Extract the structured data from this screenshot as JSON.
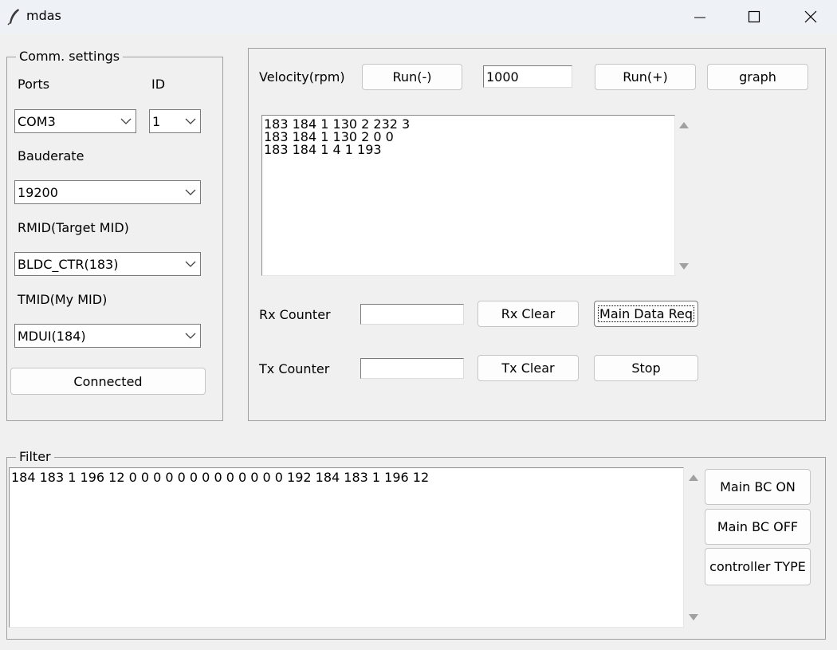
{
  "window": {
    "title": "mdas"
  },
  "comm": {
    "legend": "Comm. settings",
    "ports_label": "Ports",
    "id_label": "ID",
    "port_value": "COM3",
    "id_value": "1",
    "baud_label": "Bauderate",
    "baud_value": "19200",
    "rmid_label": "RMID(Target MID)",
    "rmid_value": "BLDC_CTR(183)",
    "tmid_label": "TMID(My MID)",
    "tmid_value": "MDUI(184)",
    "connect_label": "Connected"
  },
  "control": {
    "velocity_label": "Velocity(rpm)",
    "run_minus": "Run(-)",
    "velocity_value": "1000",
    "run_plus": "Run(+)",
    "graph": "graph",
    "log_lines": "183 184 1 130 2 232 3\n183 184 1 130 2 0 0\n183 184 1 4 1 193",
    "rx_counter_label": "Rx Counter",
    "rx_counter_value": "",
    "rx_clear": "Rx Clear",
    "main_data_req": "Main Data Req",
    "tx_counter_label": "Tx Counter",
    "tx_counter_value": "",
    "tx_clear": "Tx Clear",
    "stop": "Stop"
  },
  "filter": {
    "legend": "Filter",
    "text": "184 183 1 196 12 0 0 0 0 0 0 0 0 0 0 0 0 0 192 184 183 1 196 12",
    "main_bc_on": "Main BC ON",
    "main_bc_off": "Main BC OFF",
    "controller_type": "controller TYPE"
  },
  "colors": {
    "window_bg": "#f0f0f0",
    "titlebar_bg": "#eef2f7",
    "border": "#a0a0a0"
  },
  "icons": {
    "app": "feather-icon",
    "minimize": "minimize-icon",
    "maximize": "maximize-icon",
    "close": "close-icon",
    "dropdown": "chevron-down-icon",
    "scroll_up": "scroll-up-arrow-icon",
    "scroll_down": "scroll-down-arrow-icon"
  }
}
